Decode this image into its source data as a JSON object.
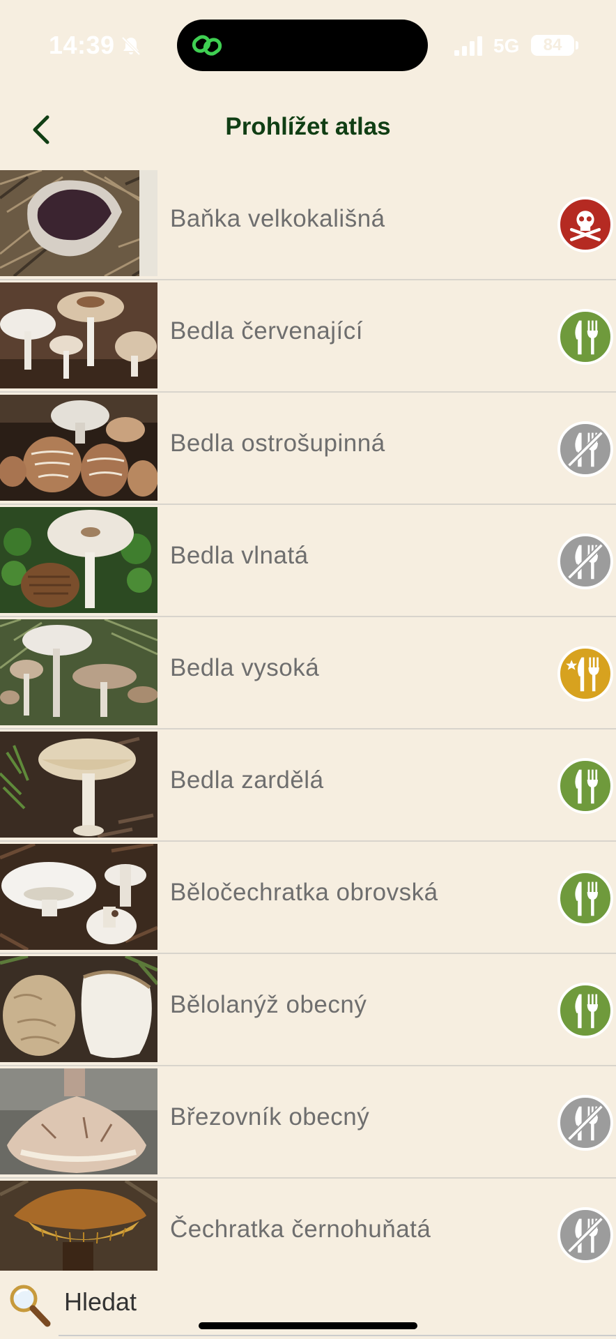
{
  "status": {
    "time": "14:39",
    "network": "5G",
    "battery": "84"
  },
  "header": {
    "title": "Prohlížet atlas"
  },
  "colors": {
    "poison": "#b52a22",
    "edible": "#6f9a3c",
    "inedible": "#9c9c9c",
    "choice": "#d7a21f",
    "title": "#103e14"
  },
  "items": [
    {
      "name": "Baňka velkokališná",
      "badge": "poisonous-icon"
    },
    {
      "name": "Bedla červenající",
      "badge": "edible-icon"
    },
    {
      "name": "Bedla ostrošupinná",
      "badge": "inedible-icon"
    },
    {
      "name": "Bedla vlnatá",
      "badge": "inedible-icon"
    },
    {
      "name": "Bedla vysoká",
      "badge": "choice-edible-icon"
    },
    {
      "name": "Bedla zardělá",
      "badge": "edible-icon"
    },
    {
      "name": "Běločechratka obrovská",
      "badge": "edible-icon"
    },
    {
      "name": "Bělolanýž obecný",
      "badge": "edible-icon"
    },
    {
      "name": "Březovník obecný",
      "badge": "inedible-icon"
    },
    {
      "name": "Čechratka černohuňatá",
      "badge": "inedible-icon"
    }
  ],
  "search": {
    "label": "Hledat"
  }
}
